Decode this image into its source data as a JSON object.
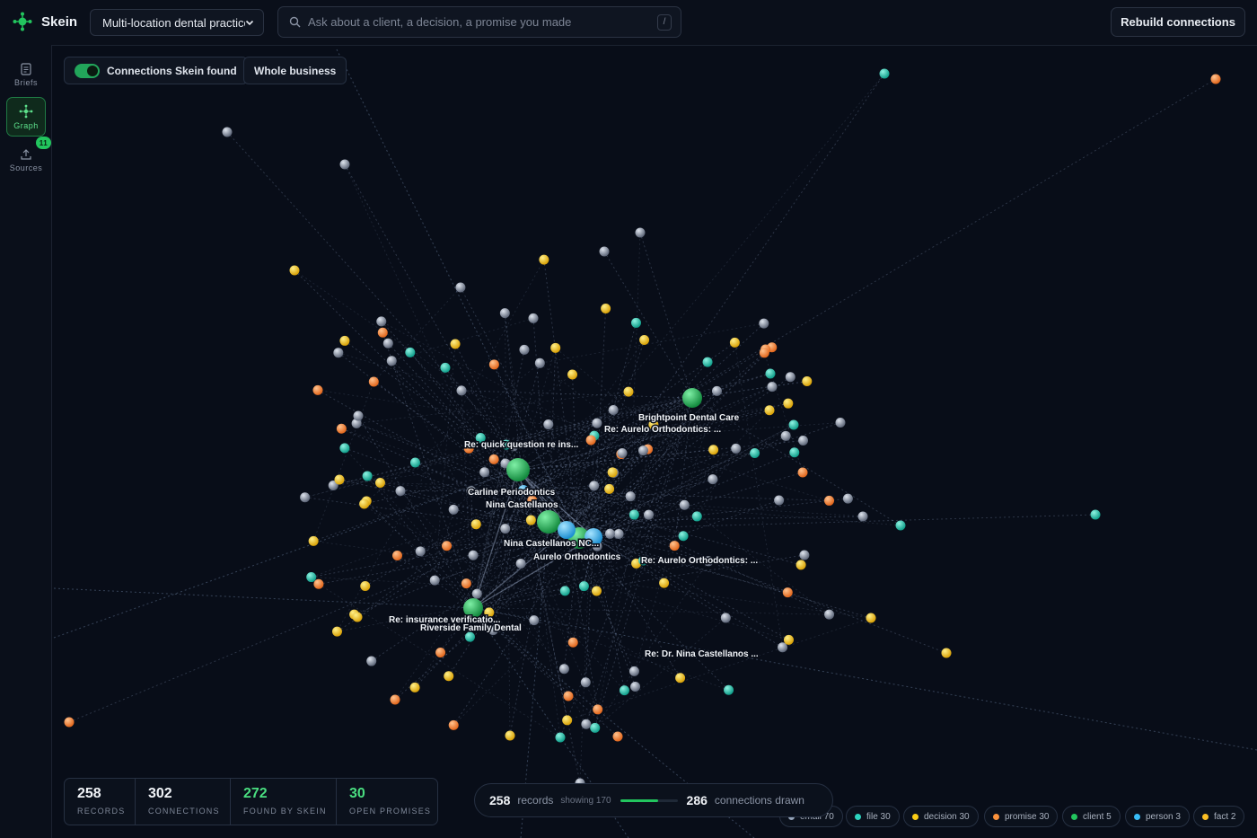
{
  "app": {
    "name": "Skein"
  },
  "header": {
    "workspace_select": "Multi-location dental practice",
    "search_placeholder": "Ask about a client, a decision, a promise you made",
    "search_shortcut": "/",
    "rebuild_label": "Rebuild connections"
  },
  "sidebar": {
    "items": [
      {
        "label": "Briefs",
        "icon": "document-icon"
      },
      {
        "label": "Graph",
        "icon": "graph-icon",
        "active": true
      },
      {
        "label": "Sources",
        "icon": "upload-icon",
        "badge": "11"
      }
    ]
  },
  "toolbar": {
    "toggle_label": "Connections Skein found",
    "toggle_on": true,
    "scope_label": "Whole business"
  },
  "graph": {
    "labels": [
      "Brightpoint Dental Care",
      "Re: Aurelo Orthodontics: ...",
      "Re: quick question re ins...",
      "Carline Periodontics",
      "Nina Castellanos",
      "Nina Castellanos NC...",
      "Aurelo Orthodontics",
      "Re: Aurelo Orthodontics: ...",
      "Re: insurance verificatio...",
      "Riverside Family Dental",
      "Re: Dr. Nina Castellanos ..."
    ]
  },
  "stats": [
    {
      "value": "258",
      "label": "RECORDS"
    },
    {
      "value": "302",
      "label": "CONNECTIONS"
    },
    {
      "value": "272",
      "label": "FOUND BY SKEIN"
    },
    {
      "value": "30",
      "label": "OPEN PROMISES"
    }
  ],
  "progress": {
    "records": "258",
    "records_label": "records",
    "showing": "showing 170",
    "drawn": "286",
    "drawn_label": "connections drawn",
    "fraction": 0.66
  },
  "legend": [
    {
      "label": "email 70",
      "color": "#94a3b8"
    },
    {
      "label": "file 30",
      "color": "#2dd4bf"
    },
    {
      "label": "decision 30",
      "color": "#facc15"
    },
    {
      "label": "promise 30",
      "color": "#fb923c"
    },
    {
      "label": "client 5",
      "color": "#22c55e"
    },
    {
      "label": "person 3",
      "color": "#38bdf8"
    },
    {
      "label": "fact 2",
      "color": "#fbbf24"
    }
  ],
  "colors": {
    "accent": "#22c55e",
    "email": "#94a3b8",
    "file": "#2dd4bf",
    "decision": "#facc15",
    "promise": "#fb923c",
    "client": "#22c55e",
    "person": "#38bdf8"
  }
}
